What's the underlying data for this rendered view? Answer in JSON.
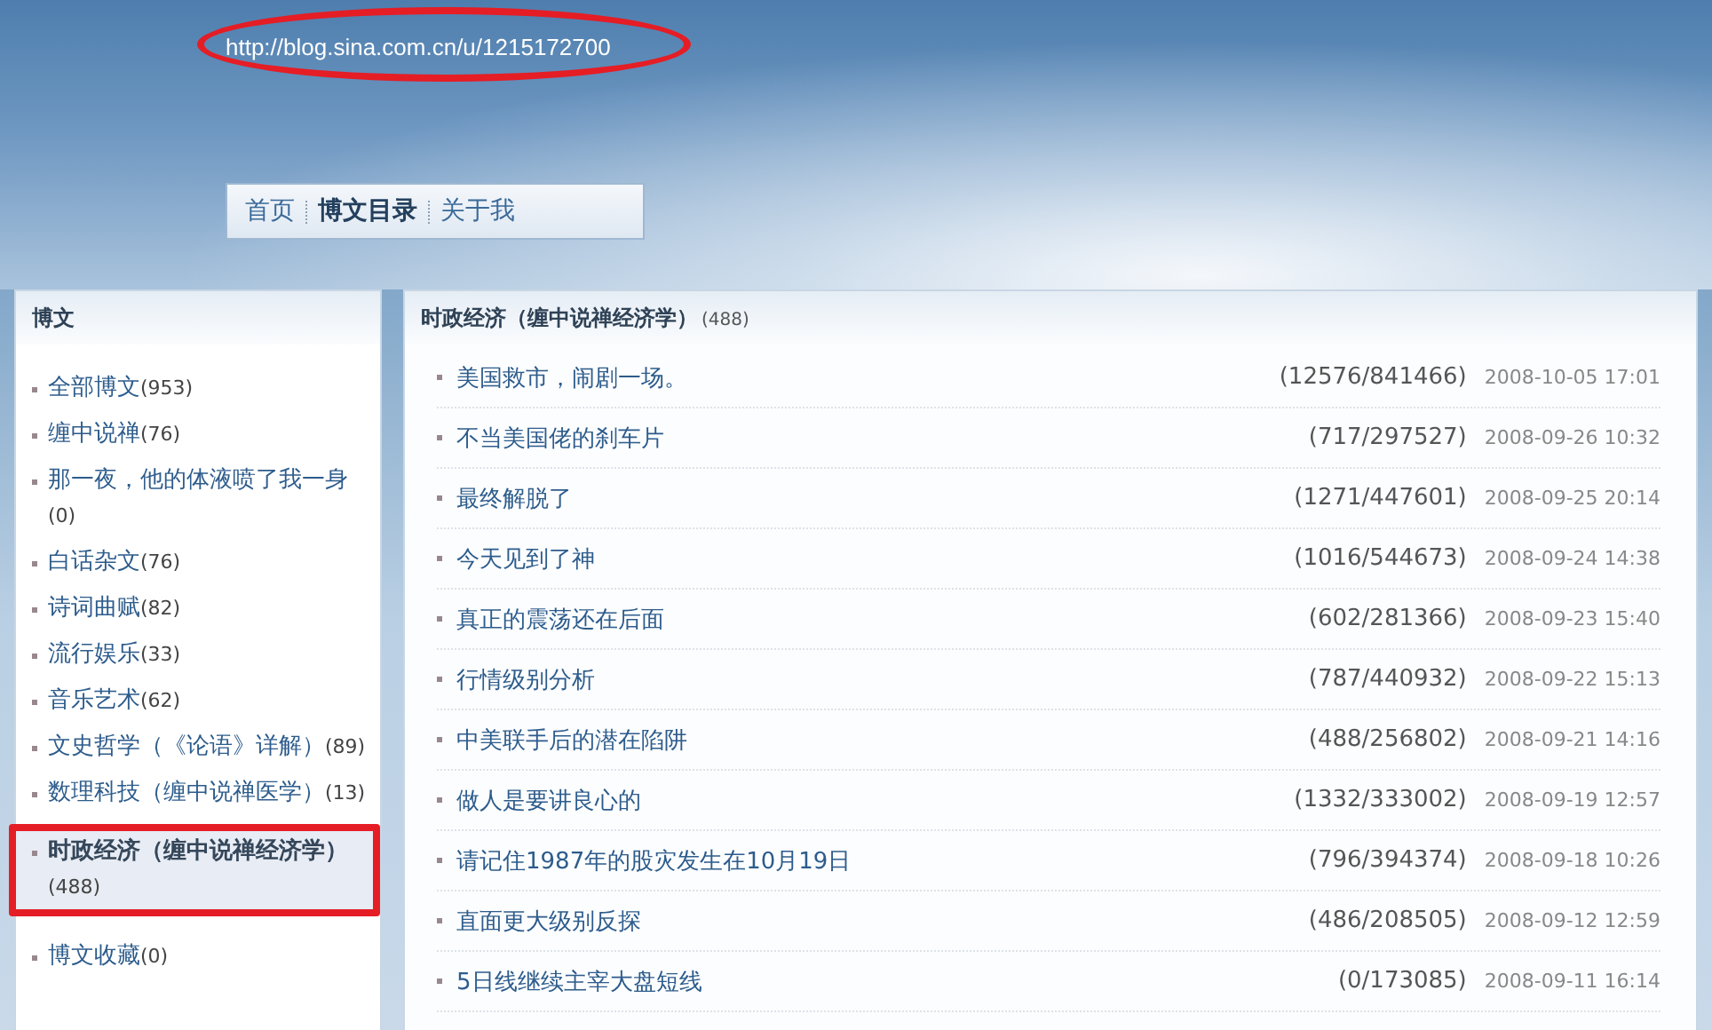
{
  "header": {
    "url": "http://blog.sina.com.cn/u/1215172700"
  },
  "nav": [
    {
      "label": "首页",
      "selected": false
    },
    {
      "label": "博文目录",
      "selected": true
    },
    {
      "label": "关于我",
      "selected": false
    }
  ],
  "sidebar": {
    "title": "博文",
    "items": [
      {
        "label": "全部博文",
        "count": "(953)",
        "selected": false
      },
      {
        "label": "缠中说禅",
        "count": "(76)",
        "selected": false
      },
      {
        "label": "那一夜，他的体液喷了我一身",
        "count": "(0)",
        "selected": false
      },
      {
        "label": "白话杂文",
        "count": "(76)",
        "selected": false
      },
      {
        "label": "诗词曲赋",
        "count": "(82)",
        "selected": false
      },
      {
        "label": "流行娱乐",
        "count": "(33)",
        "selected": false
      },
      {
        "label": "音乐艺术",
        "count": "(62)",
        "selected": false
      },
      {
        "label": "文史哲学（《论语》详解）",
        "count": "(89)",
        "selected": false
      },
      {
        "label": "数理科技（缠中说禅医学）",
        "count": "(13)",
        "selected": false
      },
      {
        "label": "时政经济（缠中说禅经济学）",
        "count": "(488)",
        "selected": true
      },
      {
        "label": "博文收藏",
        "count": "(0)",
        "selected": false
      }
    ]
  },
  "articles": {
    "title": "时政经济（缠中说禅经济学）",
    "count": "(488)",
    "rows": [
      {
        "title": "美国救市，闹剧一场。",
        "stats": "(12576/841466)",
        "date": "2008-10-05 17:01"
      },
      {
        "title": "不当美国佬的刹车片",
        "stats": "(717/297527)",
        "date": "2008-09-26 10:32"
      },
      {
        "title": "最终解脱了",
        "stats": "(1271/447601)",
        "date": "2008-09-25 20:14"
      },
      {
        "title": "今天见到了神",
        "stats": "(1016/544673)",
        "date": "2008-09-24 14:38"
      },
      {
        "title": "真正的震荡还在后面",
        "stats": "(602/281366)",
        "date": "2008-09-23 15:40"
      },
      {
        "title": "行情级别分析",
        "stats": "(787/440932)",
        "date": "2008-09-22 15:13"
      },
      {
        "title": "中美联手后的潜在陷阱",
        "stats": "(488/256802)",
        "date": "2008-09-21 14:16"
      },
      {
        "title": "做人是要讲良心的",
        "stats": "(1332/333002)",
        "date": "2008-09-19 12:57"
      },
      {
        "title": "请记住1987年的股灾发生在10月19日",
        "stats": "(796/394374)",
        "date": "2008-09-18 10:26"
      },
      {
        "title": "直面更大级别反探",
        "stats": "(486/208505)",
        "date": "2008-09-12 12:59"
      },
      {
        "title": "5日线继续主宰大盘短线",
        "stats": "(0/173085)",
        "date": "2008-09-11 16:14"
      }
    ]
  }
}
